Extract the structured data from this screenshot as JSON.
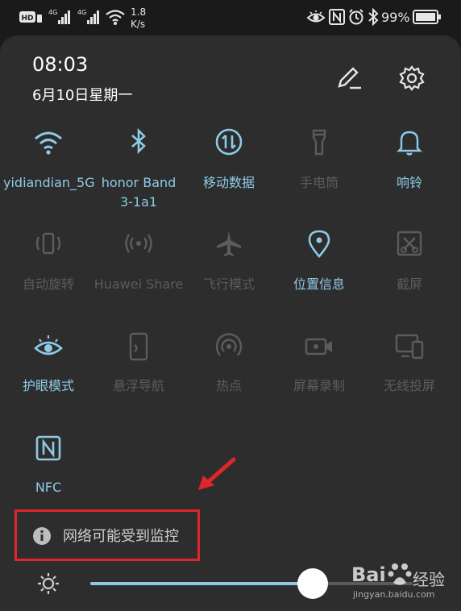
{
  "status_bar": {
    "network_speed_value": "1.8",
    "network_speed_unit": "K/s",
    "battery": "99%",
    "icons": [
      "hd-icon",
      "signal-4g-icon",
      "signal-4g-icon",
      "wifi-icon",
      "eye-icon",
      "nfc-icon",
      "alarm-icon",
      "bluetooth-icon",
      "battery-icon"
    ]
  },
  "header": {
    "time": "08:03",
    "date": "6月10日星期一"
  },
  "tiles": [
    {
      "id": "wifi",
      "label": "yidiandian_5G",
      "state": "on",
      "icon": "wifi-icon"
    },
    {
      "id": "bluetooth",
      "label": "honor Band",
      "label2": "3-1a1",
      "state": "on",
      "icon": "bluetooth-icon"
    },
    {
      "id": "mobile-data",
      "label": "移动数据",
      "state": "on",
      "icon": "mobile-data-icon"
    },
    {
      "id": "flashlight",
      "label": "手电筒",
      "state": "off",
      "icon": "flashlight-icon"
    },
    {
      "id": "ring",
      "label": "响铃",
      "state": "on",
      "icon": "bell-icon"
    },
    {
      "id": "auto-rotate",
      "label": "自动旋转",
      "state": "off",
      "icon": "rotate-icon"
    },
    {
      "id": "huawei-share",
      "label": "Huawei Share",
      "state": "off",
      "icon": "share-icon"
    },
    {
      "id": "airplane",
      "label": "飞行模式",
      "state": "off",
      "icon": "airplane-icon"
    },
    {
      "id": "location",
      "label": "位置信息",
      "state": "on",
      "icon": "location-icon"
    },
    {
      "id": "screenshot",
      "label": "截屏",
      "state": "off",
      "icon": "screenshot-icon"
    },
    {
      "id": "eye-comfort",
      "label": "护眼模式",
      "state": "on",
      "icon": "eye-icon"
    },
    {
      "id": "floating-nav",
      "label": "悬浮导航",
      "state": "off",
      "icon": "floating-nav-icon"
    },
    {
      "id": "hotspot",
      "label": "热点",
      "state": "off",
      "icon": "hotspot-icon"
    },
    {
      "id": "screen-record",
      "label": "屏幕录制",
      "state": "off",
      "icon": "screen-record-icon"
    },
    {
      "id": "wireless-projection",
      "label": "无线投屏",
      "state": "off",
      "icon": "projection-icon"
    },
    {
      "id": "nfc",
      "label": "NFC",
      "state": "on",
      "icon": "nfc-icon"
    }
  ],
  "notice": {
    "text": "网络可能受到监控",
    "icon": "info-icon"
  },
  "brightness": {
    "level": 0.69,
    "icon": "brightness-icon"
  },
  "watermark": {
    "brand": "Bai",
    "brand2": "经验",
    "url": "jingyan.baidu.com"
  },
  "colors": {
    "active": "#8ecae6",
    "inactive": "#5c5c5c",
    "annotation": "#e0262b",
    "panel": "#2d2d2d"
  }
}
